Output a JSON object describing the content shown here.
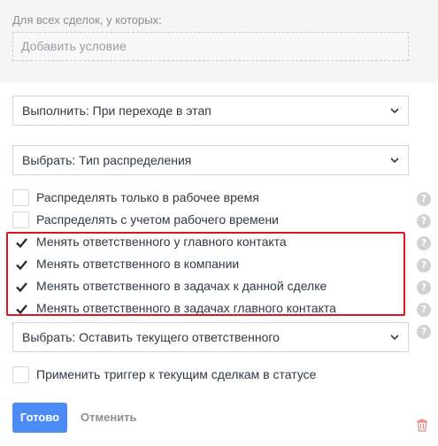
{
  "conditions": {
    "title": "Для всех сделок, у которых:",
    "add_placeholder": "Добавить условие"
  },
  "selects": {
    "execute": "Выполнить: При переходе в этап",
    "distribution_type": "Выбрать: Тип распределения",
    "responsible": "Выбрать: Оставить текущего ответственного"
  },
  "options": [
    {
      "label": "Распределять только в рабочее время",
      "checked": false
    },
    {
      "label": "Распределять с учетом рабочего времени",
      "checked": false
    },
    {
      "label": "Менять ответственного у главного контакта",
      "checked": true
    },
    {
      "label": "Менять ответственного в компании",
      "checked": true
    },
    {
      "label": "Менять ответственного в задачах к данной сделке",
      "checked": true
    },
    {
      "label": "Менять ответственного в задачах главного контакта",
      "checked": true
    }
  ],
  "apply_trigger": {
    "label": "Применить триггер к текущим сделкам в статусе",
    "checked": false
  },
  "help_glyph": "?",
  "buttons": {
    "done": "Готово",
    "cancel": "Отменить"
  },
  "colors": {
    "accent": "#4c8bf5",
    "highlight": "#e0141e",
    "trash": "#e88b85"
  },
  "icons": [
    "chevron-down-icon",
    "checkmark-icon",
    "help-icon",
    "trash-icon"
  ]
}
